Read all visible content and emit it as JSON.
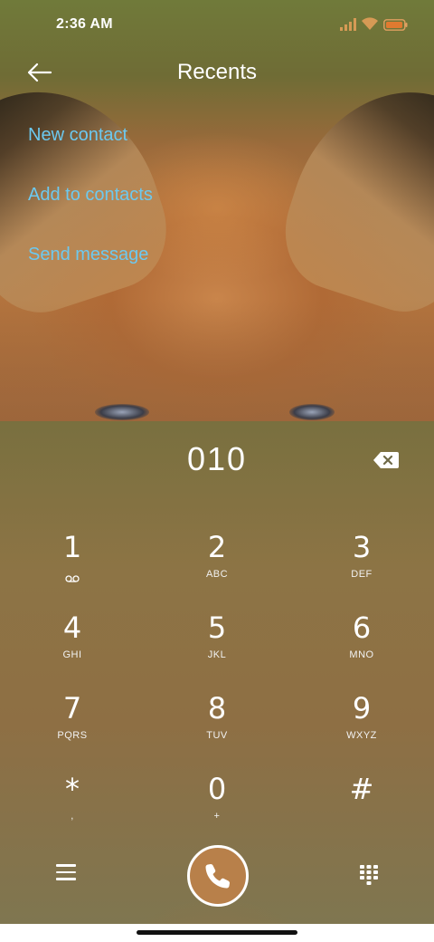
{
  "status_bar": {
    "time": "2:36 AM",
    "icons": [
      "signal-icon",
      "wifi-icon",
      "battery-icon"
    ]
  },
  "header": {
    "title": "Recents",
    "back_icon": "back-arrow-icon"
  },
  "actions": [
    {
      "label": "New contact"
    },
    {
      "label": "Add to contacts"
    },
    {
      "label": "Send message"
    }
  ],
  "dialer": {
    "number": "010",
    "backspace_icon": "backspace-icon"
  },
  "keypad": [
    {
      "digit": "1",
      "letters": ""
    },
    {
      "digit": "2",
      "letters": "ABC"
    },
    {
      "digit": "3",
      "letters": "DEF"
    },
    {
      "digit": "4",
      "letters": "GHI"
    },
    {
      "digit": "5",
      "letters": "JKL"
    },
    {
      "digit": "6",
      "letters": "MNO"
    },
    {
      "digit": "7",
      "letters": "PQRS"
    },
    {
      "digit": "8",
      "letters": "TUV"
    },
    {
      "digit": "9",
      "letters": "WXYZ"
    },
    {
      "digit": "*",
      "letters": ","
    },
    {
      "digit": "0",
      "letters": "+"
    },
    {
      "digit": "#",
      "letters": ""
    }
  ],
  "bottom_bar": {
    "menu_icon": "menu-icon",
    "call_icon": "phone-icon",
    "dialpad_icon": "dialpad-icon"
  },
  "colors": {
    "link": "#6cc9f0",
    "call_button": "#b8804a"
  }
}
